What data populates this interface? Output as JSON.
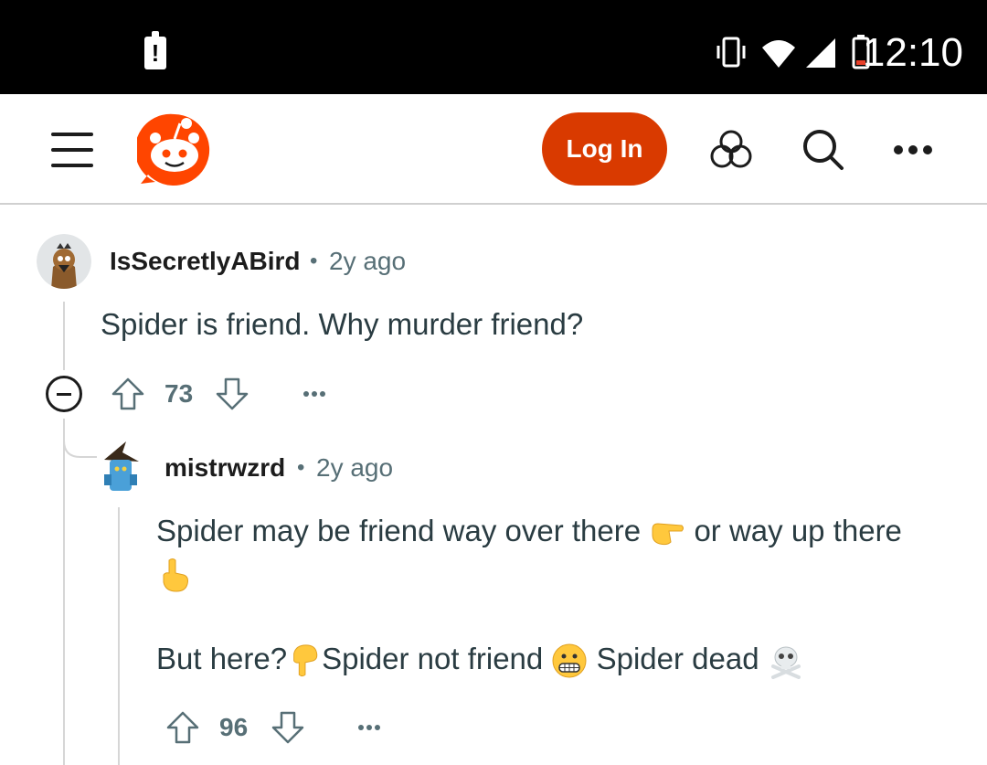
{
  "status_bar": {
    "time": "12:10",
    "alert_glyph": "!",
    "icons": [
      "vibrate-icon",
      "wifi-icon",
      "cell-signal-icon",
      "battery-low-icon"
    ]
  },
  "header": {
    "login_label": "Log In",
    "brand_color": "#d93a00",
    "icons": [
      "menu-icon",
      "reddit-logo",
      "explore-icon",
      "search-icon",
      "more-icon"
    ]
  },
  "comments": [
    {
      "author": "IsSecretlyABird",
      "separator": "•",
      "age": "2y ago",
      "body": "Spider is friend. Why murder friend?",
      "score": "73"
    },
    {
      "author": "mistrwzrd",
      "separator": "•",
      "age": "2y ago",
      "body_line1_a": "Spider may be friend way over there",
      "body_line1_b": "or way up there",
      "body_line3_a": "But here?",
      "body_line3_b": "Spider not friend",
      "body_line3_c": "Spider dead",
      "emojis": [
        "pointing-right-emoji",
        "pointing-up-emoji",
        "pointing-down-emoji",
        "grimacing-face-emoji",
        "skull-crossbones-emoji"
      ],
      "score": "96"
    }
  ]
}
